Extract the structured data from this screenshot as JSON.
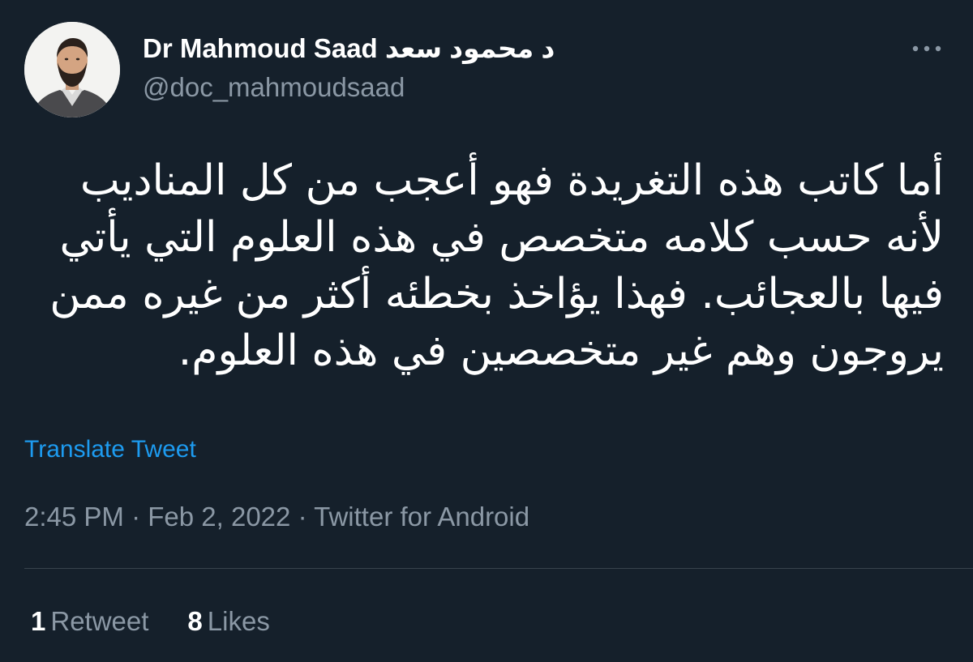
{
  "author": {
    "name": "Dr Mahmoud Saad د محمود سعد",
    "handle": "@doc_mahmoudsaad",
    "avatar_icon": "profile-photo"
  },
  "more_icon": "more-dots-icon",
  "tweet": {
    "text": "أما كاتب هذه التغريدة فهو أعجب من كل المناديب لأنه حسب كلامه متخصص في هذه العلوم التي يأتي فيها بالعجائب. فهذا يؤاخذ بخطئه أكثر من غيره ممن يروجون وهم غير متخصصين في هذه العلوم.",
    "translate_label": "Translate Tweet",
    "time": "2:45 PM",
    "date": "Feb 2, 2022",
    "source": "Twitter for Android",
    "separator": "·"
  },
  "stats": {
    "retweets_count": "1",
    "retweets_label": "Retweet",
    "likes_count": "8",
    "likes_label": "Likes"
  },
  "colors": {
    "background": "#15202b",
    "text": "#ffffff",
    "secondary": "#8b98a5",
    "link": "#1d9bf0",
    "divider": "#38444d"
  }
}
